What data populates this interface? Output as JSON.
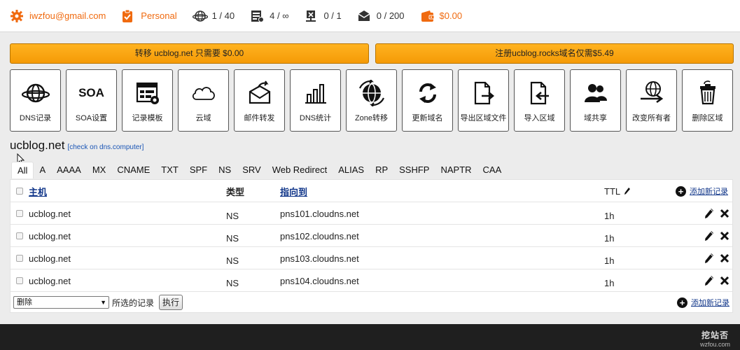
{
  "topbar": {
    "email": "iwzfou@gmail.com",
    "plan": "Personal",
    "zones": "1 / 40",
    "records": "4 / ∞",
    "secondary": "0 / 1",
    "mail_forwards": "0 / 200",
    "balance": "$0.00",
    "accent_color": "#f06a0f"
  },
  "promos": {
    "transfer": "转移 ucblog.net 只需要 $0.00",
    "register": "注册ucblog.rocks域名仅需$5.49"
  },
  "tools": [
    {
      "label": "DNS记录",
      "icon": "globe-icon"
    },
    {
      "label": "SOA设置",
      "icon": "soa-text-icon",
      "glyph": "SOA"
    },
    {
      "label": "记录模板",
      "icon": "template-icon"
    },
    {
      "label": "云域",
      "icon": "cloud-icon"
    },
    {
      "label": "邮件转发",
      "icon": "mail-forward-icon"
    },
    {
      "label": "DNS统计",
      "icon": "bar-chart-icon"
    },
    {
      "label": "Zone转移",
      "icon": "globe-transfer-icon"
    },
    {
      "label": "更新域名",
      "icon": "refresh-icon"
    },
    {
      "label": "导出区域文件",
      "icon": "export-file-icon"
    },
    {
      "label": "导入区域",
      "icon": "import-file-icon"
    },
    {
      "label": "域共享",
      "icon": "users-icon"
    },
    {
      "label": "改变所有者",
      "icon": "change-owner-icon"
    },
    {
      "label": "删除区域",
      "icon": "trash-icon"
    }
  ],
  "domain": {
    "name": "ucblog.net",
    "check_link": "[check on dns.computer]"
  },
  "tabs": [
    "All",
    "A",
    "AAAA",
    "MX",
    "CNAME",
    "TXT",
    "SPF",
    "NS",
    "SRV",
    "Web Redirect",
    "ALIAS",
    "RP",
    "SSHFP",
    "NAPTR",
    "CAA"
  ],
  "table": {
    "headers": {
      "host": "主机",
      "type": "类型",
      "points_to": "指向到",
      "ttl": "TTL",
      "add_record": "添加新记录"
    },
    "rows": [
      {
        "host": "ucblog.net",
        "type": "NS",
        "points_to": "pns101.cloudns.net",
        "ttl": "1h"
      },
      {
        "host": "ucblog.net",
        "type": "NS",
        "points_to": "pns102.cloudns.net",
        "ttl": "1h"
      },
      {
        "host": "ucblog.net",
        "type": "NS",
        "points_to": "pns103.cloudns.net",
        "ttl": "1h"
      },
      {
        "host": "ucblog.net",
        "type": "NS",
        "points_to": "pns104.cloudns.net",
        "ttl": "1h"
      }
    ]
  },
  "footer": {
    "action_selected": "删除",
    "selected_records_label": "所选的记录",
    "execute_label": "执行",
    "add_record": "添加新记录"
  },
  "watermark": {
    "brand": "挖站否",
    "site": "wzfou.com"
  }
}
